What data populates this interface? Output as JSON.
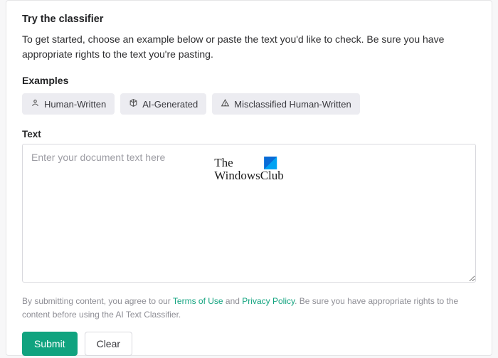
{
  "heading": "Try the classifier",
  "intro": "To get started, choose an example below or paste the text you'd like to check. Be sure you have appropriate rights to the text you're pasting.",
  "examples": {
    "label": "Examples",
    "items": [
      {
        "label": "Human-Written"
      },
      {
        "label": "AI-Generated"
      },
      {
        "label": "Misclassified Human-Written"
      }
    ]
  },
  "text_section": {
    "label": "Text",
    "placeholder": "Enter your document text here",
    "value": ""
  },
  "watermark": {
    "line1": "The",
    "line2": "WindowsClub"
  },
  "disclaimer": {
    "prefix": "By submitting content, you agree to our ",
    "terms": "Terms of Use",
    "and": " and ",
    "privacy": "Privacy Policy",
    "suffix": ". Be sure you have appropriate rights to the content before using the AI Text Classifier."
  },
  "buttons": {
    "submit": "Submit",
    "clear": "Clear"
  }
}
